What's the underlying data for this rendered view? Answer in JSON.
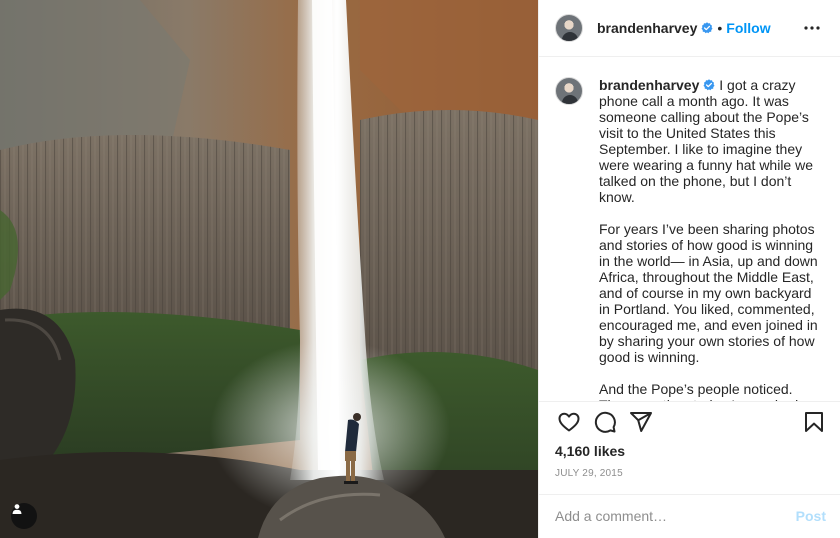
{
  "header": {
    "username": "brandenharvey",
    "separator": "•",
    "follow_label": "Follow"
  },
  "caption": {
    "username": "brandenharvey",
    "paragraphs": [
      "I got a crazy phone call a month ago. It was someone calling about the Pope’s visit to the United States this September. I like to imagine they were wearing a funny hat while we talked on the phone, but I don’t know.",
      "For years I’ve been sharing photos and stories of how good is winning in the world— in Asia, up and down Africa, throughout the Middle East, and of course in my own backyard in Portland. You liked, commented, encouraged me, and even joined in by sharing your own stories of how good is winning.",
      "And the Pope’s people noticed. They saw the stories I was sharing and they"
    ]
  },
  "post": {
    "likes": "4,160 likes",
    "date": "JULY 29, 2015"
  },
  "comment": {
    "placeholder": "Add a comment…",
    "post_label": "Post"
  },
  "icons": {
    "verified": "verified-badge-icon",
    "more": "more-options-icon",
    "like": "heart-icon",
    "comment": "comment-icon",
    "share": "paper-plane-icon",
    "save": "bookmark-icon",
    "user_tag": "user-tag-icon"
  },
  "colors": {
    "accent": "#0095f6",
    "post_disabled": "#b2dffc",
    "muted": "#8e8e8e"
  }
}
